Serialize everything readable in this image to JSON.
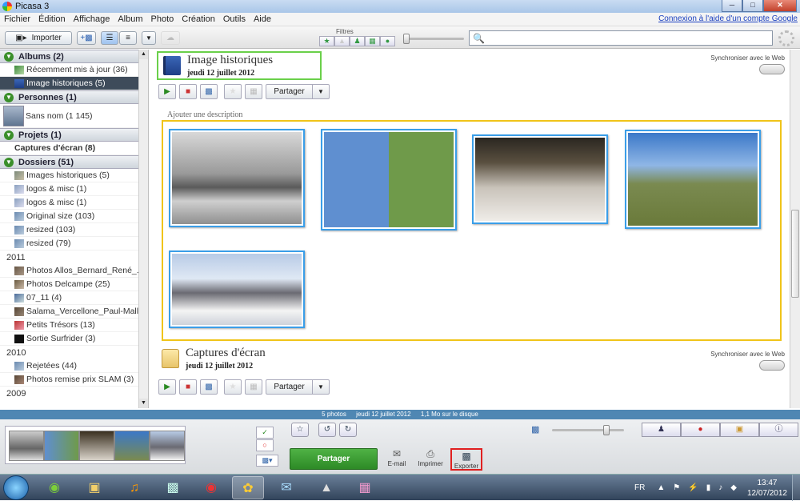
{
  "window": {
    "title": "Picasa 3",
    "min": "─",
    "max": "□",
    "close": "✕"
  },
  "menu": {
    "items": [
      "Fichier",
      "Édition",
      "Affichage",
      "Album",
      "Photo",
      "Création",
      "Outils",
      "Aide"
    ],
    "login_link": "Connexion à l'aide d'un compte Google"
  },
  "toolbar": {
    "import_label": "Importer",
    "filters_label": "Filtres",
    "search_placeholder": "",
    "search_icon": "🔍"
  },
  "sidebar": {
    "albums_header": "Albums (2)",
    "albums": [
      {
        "label": "Récemment mis à jour (36)"
      },
      {
        "label": "Image historiques (5)"
      }
    ],
    "people_header": "Personnes (1)",
    "people": [
      {
        "label": "Sans nom (1 145)"
      }
    ],
    "projects_header": "Projets (1)",
    "projects": [
      {
        "label": "Captures d'écran (8)"
      }
    ],
    "folders_header": "Dossiers (51)",
    "folders": [
      {
        "label": "Images historiques (5)"
      },
      {
        "label": "logos & misc (1)"
      },
      {
        "label": "logos & misc (1)"
      },
      {
        "label": "Original size (103)"
      },
      {
        "label": "resized (103)"
      },
      {
        "label": "resized (79)"
      }
    ],
    "year_2011": "2011",
    "folders_2011": [
      {
        "label": "Photos Allos_Bernard_René_..."
      },
      {
        "label": "Photos Delcampe (25)"
      },
      {
        "label": "07_11 (4)"
      },
      {
        "label": "Salama_Vercellone_Paul-Malle..."
      },
      {
        "label": "Petits Trésors (13)"
      },
      {
        "label": "Sortie Surfrider (3)"
      }
    ],
    "year_2010": "2010",
    "folders_2010": [
      {
        "label": "Rejetées (44)"
      },
      {
        "label": "Photos remise prix  SLAM (3)"
      }
    ],
    "year_2009": "2009"
  },
  "main": {
    "folder1": {
      "title": "Image historiques",
      "date": "jeudi 12 juillet 2012",
      "sync": "Synchroniser avec le Web",
      "share": "Partager",
      "description": "Ajouter une description"
    },
    "folder2": {
      "title": "Captures d'écran",
      "date": "jeudi 12 juillet 2012",
      "sync": "Synchroniser avec le Web",
      "share": "Partager"
    }
  },
  "status": {
    "count": "5 photos",
    "date": "jeudi 12 juillet 2012",
    "size": "1,1 Mo sur le disque"
  },
  "bottom": {
    "share_label": "Partager",
    "email": "E-mail",
    "print": "Imprimer",
    "export": "Exporter"
  },
  "taskbar": {
    "lang": "FR",
    "time": "13:47",
    "date": "12/07/2012"
  }
}
